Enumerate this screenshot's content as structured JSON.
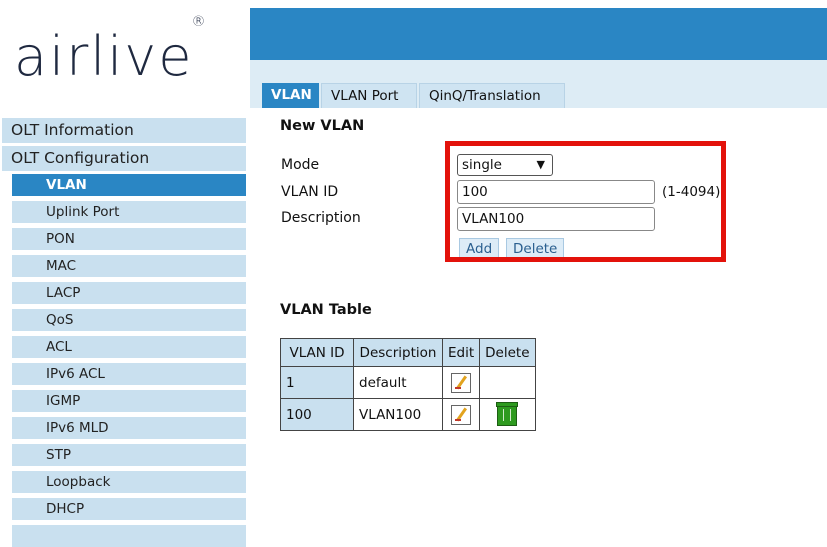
{
  "brand": {
    "logo_text": "airlive",
    "registered_mark": "®"
  },
  "tabs": [
    {
      "label": "VLAN",
      "active": true
    },
    {
      "label": "VLAN Port",
      "active": false
    },
    {
      "label": "QinQ/Translation",
      "active": false
    }
  ],
  "sidebar": {
    "sections": [
      "OLT Information",
      "OLT Configuration"
    ],
    "items": [
      {
        "label": "VLAN",
        "active": true
      },
      {
        "label": "Uplink Port"
      },
      {
        "label": "PON"
      },
      {
        "label": "MAC"
      },
      {
        "label": "LACP"
      },
      {
        "label": "QoS"
      },
      {
        "label": "ACL"
      },
      {
        "label": "IPv6 ACL"
      },
      {
        "label": "IGMP"
      },
      {
        "label": "IPv6 MLD"
      },
      {
        "label": "STP"
      },
      {
        "label": "Loopback"
      },
      {
        "label": "DHCP"
      }
    ]
  },
  "new_vlan": {
    "heading": "New VLAN",
    "mode_label": "Mode",
    "mode_value": "single",
    "vlan_id_label": "VLAN ID",
    "vlan_id_value": "100",
    "vlan_id_range": "(1-4094)",
    "description_label": "Description",
    "description_value": "VLAN100",
    "add_label": "Add",
    "delete_label": "Delete"
  },
  "vlan_table": {
    "heading": "VLAN Table",
    "columns": [
      "VLAN ID",
      "Description",
      "Edit",
      "Delete"
    ],
    "rows": [
      {
        "vlan_id": "1",
        "description": "default",
        "editable": true,
        "deletable": false
      },
      {
        "vlan_id": "100",
        "description": "VLAN100",
        "editable": true,
        "deletable": true
      }
    ]
  },
  "colors": {
    "accent": "#2a86c4",
    "highlight_box": "#e3120b",
    "light_blue": "#c9e0ef"
  },
  "icons": {
    "edit": "edit-pencil-icon",
    "delete": "trash-icon",
    "dropdown": "chevron-down-icon"
  }
}
